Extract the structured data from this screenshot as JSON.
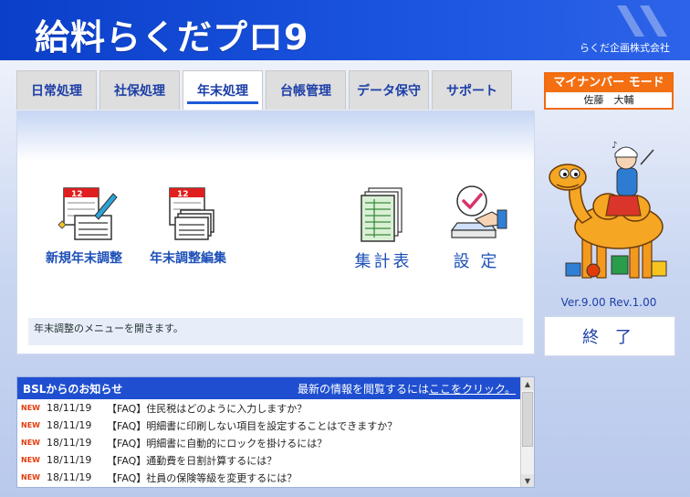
{
  "app": {
    "logo_text": "給料らくだプロ9",
    "company": "らくだ企画株式会社"
  },
  "tabs": [
    {
      "label": "日常処理"
    },
    {
      "label": "社保処理"
    },
    {
      "label": "年末処理",
      "active": true
    },
    {
      "label": "台帳管理"
    },
    {
      "label": "データ保守"
    },
    {
      "label": "サポート"
    }
  ],
  "menu": {
    "items": [
      {
        "label": "新規年末調整",
        "icon": "calendar-pen-icon"
      },
      {
        "label": "年末調整編集",
        "icon": "calendar-stack-icon"
      },
      {
        "label": "集計表",
        "icon": "spreadsheet-icon"
      },
      {
        "label": "設 定",
        "icon": "settings-check-icon"
      }
    ],
    "hint": "年末調整のメニューを開きます。"
  },
  "mynumber": {
    "title": "マイナンバー モード",
    "user": "佐藤　大輔"
  },
  "mascot": {
    "icon": "camel-mascot-icon"
  },
  "version": "Ver.9.00 Rev.1.00",
  "exit_label": "終 了",
  "news": {
    "title": "BSLからのお知らせ",
    "prompt": "最新の情報を閲覧するには",
    "link": "ここをクリック。",
    "badge": "NEW",
    "items": [
      {
        "date": "18/11/19",
        "text": "【FAQ】住民税はどのように入力しますか？"
      },
      {
        "date": "18/11/19",
        "text": "【FAQ】明細書に印刷しない項目を設定することはできますか？"
      },
      {
        "date": "18/11/19",
        "text": "【FAQ】明細書に自動的にロックを掛けるには？"
      },
      {
        "date": "18/11/19",
        "text": "【FAQ】通勤費を日割計算するには？"
      },
      {
        "date": "18/11/19",
        "text": "【FAQ】社員の保険等級を変更するには？"
      }
    ]
  },
  "colors": {
    "brand_blue": "#1b55e0",
    "accent_orange": "#f36f12",
    "new_red": "#e23b0a"
  }
}
